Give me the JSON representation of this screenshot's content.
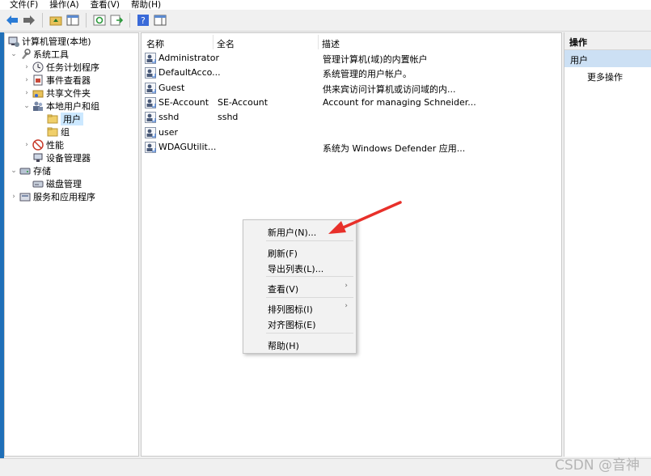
{
  "menu": [
    "文件(F)",
    "操作(A)",
    "查看(V)",
    "帮助(H)"
  ],
  "tree": {
    "root": "计算机管理(本地)",
    "system_tools": "系统工具",
    "task_scheduler": "任务计划程序",
    "event_viewer": "事件查看器",
    "shared_folders": "共享文件夹",
    "local_users": "本地用户和组",
    "users": "用户",
    "groups": "组",
    "performance": "性能",
    "device_manager": "设备管理器",
    "storage": "存储",
    "disk_management": "磁盘管理",
    "services": "服务和应用程序"
  },
  "list": {
    "columns": [
      "名称",
      "全名",
      "描述"
    ],
    "rows": [
      {
        "name": "Administrator",
        "fullname": "",
        "desc": "管理计算机(域)的内置帐户"
      },
      {
        "name": "DefaultAcco...",
        "fullname": "",
        "desc": "系统管理的用户帐户。"
      },
      {
        "name": "Guest",
        "fullname": "",
        "desc": "供来宾访问计算机或访问域的内..."
      },
      {
        "name": "SE-Account",
        "fullname": "SE-Account",
        "desc": "Account for managing Schneider..."
      },
      {
        "name": "sshd",
        "fullname": "sshd",
        "desc": ""
      },
      {
        "name": "user",
        "fullname": "",
        "desc": ""
      },
      {
        "name": "WDAGUtilit...",
        "fullname": "",
        "desc": "系统为 Windows Defender 应用..."
      }
    ]
  },
  "actions": {
    "header": "操作",
    "section": "用户",
    "more": "更多操作"
  },
  "context_menu": {
    "new_user": "新用户(N)...",
    "refresh": "刷新(F)",
    "export": "导出列表(L)...",
    "view": "查看(V)",
    "arrange": "排列图标(I)",
    "align": "对齐图标(E)",
    "help": "帮助(H)"
  },
  "watermark": "CSDN @音神",
  "colors": {
    "selection": "#cce8ff",
    "action_section": "#cce0f4",
    "arrow": "#e8302a"
  }
}
